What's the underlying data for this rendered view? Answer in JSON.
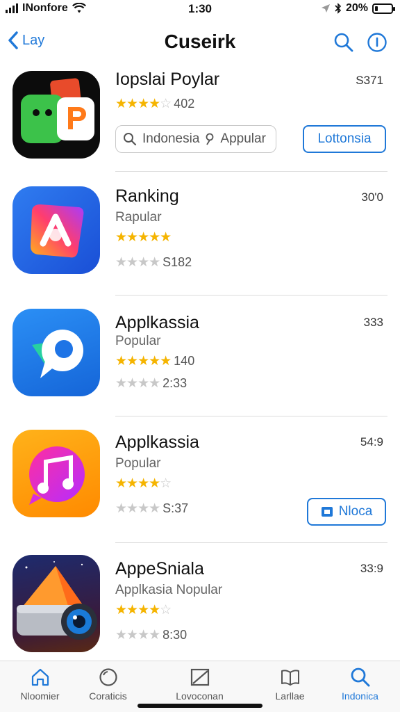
{
  "status": {
    "carrier": "INonfore",
    "time": "1:30",
    "battery": "20%",
    "battery_level": 0.2
  },
  "nav": {
    "back_label": "Lay",
    "title": "Cuseirk"
  },
  "apps": [
    {
      "name": "Iopslai Poylar",
      "size": "S371",
      "rating": 4,
      "rating_count": "402",
      "search_placeholder_left": "Indonesia",
      "search_placeholder_right": "Appular",
      "button_label": "Lottonsia",
      "icon": "chat-bubbles-icon"
    },
    {
      "name": "Ranking",
      "size": "30'0",
      "subtitle": "Rapular",
      "rating": 5,
      "secondary_rating": 4,
      "secondary_count": "S182",
      "icon": "camera-gradient-icon"
    },
    {
      "name": "Applkassia",
      "size": "333",
      "subtitle": "Popular",
      "rating": 5,
      "rating_count": "140",
      "secondary_rating": 4,
      "secondary_count": "2:33",
      "icon": "blue-p-icon"
    },
    {
      "name": "Applkassia",
      "size": "54:9",
      "subtitle": "Popular",
      "rating": 4,
      "secondary_rating": 4,
      "secondary_count": "S:37",
      "button_label": "Nloca",
      "icon": "music-note-icon"
    },
    {
      "name": "AppeSniala",
      "size": "33:9",
      "subtitle": "Applkasia Nopular",
      "rating": 4,
      "secondary_rating": 4,
      "secondary_count": "8:30",
      "icon": "projector-icon"
    }
  ],
  "tabs": [
    {
      "label": "Nloomier",
      "icon": "home-icon",
      "active": false
    },
    {
      "label": "Coraticis",
      "icon": "circle-icon",
      "active": false
    },
    {
      "label": "Lovoconan",
      "icon": "square-slash-icon",
      "active": false
    },
    {
      "label": "Larllae",
      "icon": "book-icon",
      "active": false
    },
    {
      "label": "Indonica",
      "icon": "search-icon",
      "active": true
    }
  ],
  "colors": {
    "accent": "#1f78d8",
    "star": "#f5b400"
  }
}
